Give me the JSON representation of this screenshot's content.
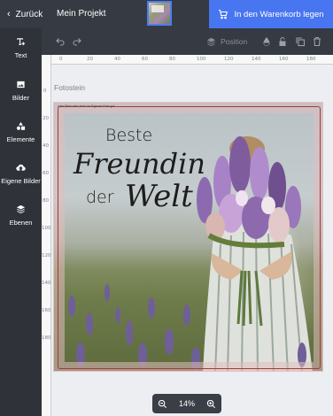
{
  "topbar": {
    "back_label": "Zurück",
    "project_name": "Mein Projekt",
    "cart_label": "In den Warenkorb legen",
    "accent": "#4876f0"
  },
  "sidebar": {
    "items": [
      {
        "label": "Text",
        "icon": "text-add-icon"
      },
      {
        "label": "Bilder",
        "icon": "image-icon"
      },
      {
        "label": "Elemente",
        "icon": "shapes-icon"
      },
      {
        "label": "Eigene Bilder",
        "icon": "upload-cloud-icon"
      },
      {
        "label": "Ebenen",
        "icon": "layers-icon"
      }
    ]
  },
  "toolbar": {
    "position_label": "Position"
  },
  "ruler": {
    "h_ticks": [
      "0",
      "20",
      "40",
      "60",
      "80",
      "100",
      "120",
      "140",
      "160",
      "180"
    ],
    "v_ticks": [
      "0",
      "20",
      "40",
      "60",
      "80",
      "100",
      "120",
      "140",
      "160",
      "180"
    ]
  },
  "canvas": {
    "label": "Fotostein",
    "tiny_text": "oder Stein wird oben im Eigenen Foto gut",
    "headline": {
      "word1": "Beste",
      "word2": "Freundin",
      "word3": "der",
      "word4": "Welt"
    }
  },
  "zoom": {
    "value": "14%"
  }
}
